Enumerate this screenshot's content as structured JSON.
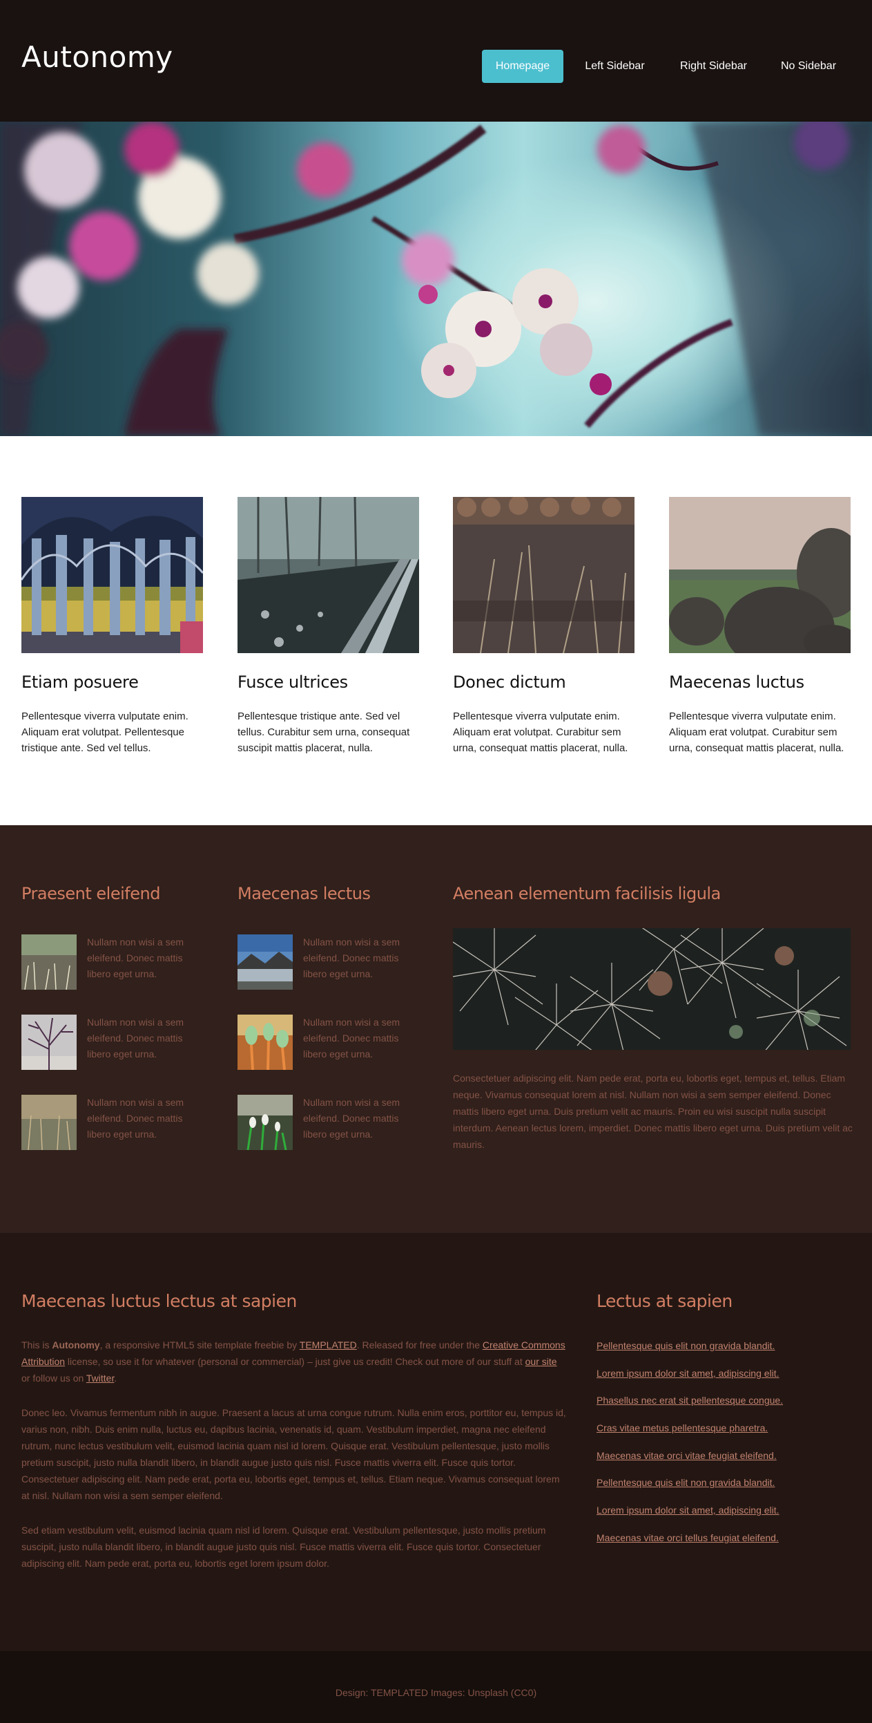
{
  "header": {
    "logo": "Autonomy",
    "nav": [
      "Homepage",
      "Left Sidebar",
      "Right Sidebar",
      "No Sidebar"
    ],
    "active_nav": "Homepage",
    "accent_color": "#4cbfcf"
  },
  "features": [
    {
      "title": "Etiam posuere",
      "text": "Pellentesque viverra vulputate enim. Aliquam erat volutpat. Pellentesque tristique ante. Sed vel tellus."
    },
    {
      "title": "Fusce ultrices",
      "text": "Pellentesque tristique ante. Sed vel tellus. Curabitur sem urna, consequat suscipit mattis placerat, nulla."
    },
    {
      "title": "Donec dictum",
      "text": "Pellentesque viverra vulputate enim. Aliquam erat volutpat. Curabitur sem urna, consequat mattis placerat, nulla."
    },
    {
      "title": "Maecenas luctus",
      "text": "Pellentesque viverra vulputate enim. Aliquam erat volutpat. Curabitur sem urna, consequat mattis placerat, nulla."
    }
  ],
  "mid": {
    "col1": {
      "title": "Praesent eleifend",
      "items": [
        "Nullam non wisi a sem eleifend. Donec mattis libero eget urna.",
        "Nullam non wisi a sem eleifend. Donec mattis libero eget urna.",
        "Nullam non wisi a sem eleifend. Donec mattis libero eget urna."
      ]
    },
    "col2": {
      "title": "Maecenas lectus",
      "items": [
        "Nullam non wisi a sem eleifend. Donec mattis libero eget urna.",
        "Nullam non wisi a sem eleifend. Donec mattis libero eget urna.",
        "Nullam non wisi a sem eleifend. Donec mattis libero eget urna."
      ]
    },
    "col3": {
      "title": "Aenean elementum facilisis ligula",
      "text": "Consectetuer adipiscing elit. Nam pede erat, porta eu, lobortis eget, tempus et, tellus. Etiam neque. Vivamus consequat lorem at nisl. Nullam non wisi a sem semper eleifend. Donec mattis libero eget urna. Duis pretium velit ac mauris. Proin eu wisi suscipit nulla suscipit interdum. Aenean lectus lorem, imperdiet. Donec mattis libero eget urna. Duis pretium velit ac mauris."
    }
  },
  "lower": {
    "left_title": "Maecenas luctus lectus at sapien",
    "intro": {
      "p1": "This is ",
      "brand": "Autonomy",
      "p2": ", a responsive HTML5 site template freebie by ",
      "link1": "TEMPLATED",
      "p3": ". Released for free under the ",
      "link2": "Creative Commons Attribution",
      "p4": " license, so use it for whatever (personal or commercial) – just give us credit! Check out more of our stuff at ",
      "link3": "our site",
      "p5": " or follow us on ",
      "link4": "Twitter",
      "p6": "."
    },
    "para2": "Donec leo. Vivamus fermentum nibh in augue. Praesent a lacus at urna congue rutrum. Nulla enim eros, porttitor eu, tempus id, varius non, nibh. Duis enim nulla, luctus eu, dapibus lacinia, venenatis id, quam. Vestibulum imperdiet, magna nec eleifend rutrum, nunc lectus vestibulum velit, euismod lacinia quam nisl id lorem. Quisque erat. Vestibulum pellentesque, justo mollis pretium suscipit, justo nulla blandit libero, in blandit augue justo quis nisl. Fusce mattis viverra elit. Fusce quis tortor. Consectetuer adipiscing elit. Nam pede erat, porta eu, lobortis eget, tempus et, tellus. Etiam neque. Vivamus consequat lorem at nisl. Nullam non wisi a sem semper eleifend.",
    "para3": "Sed etiam vestibulum velit, euismod lacinia quam nisl id lorem. Quisque erat. Vestibulum pellentesque, justo mollis pretium suscipit, justo nulla blandit libero, in blandit augue justo quis nisl. Fusce mattis viverra elit. Fusce quis tortor. Consectetuer adipiscing elit. Nam pede erat, porta eu, lobortis eget lorem ipsum dolor.",
    "right_title": "Lectus at sapien",
    "links": [
      "Pellentesque quis elit non gravida blandit.",
      "Lorem ipsum dolor sit amet, adipiscing elit.",
      "Phasellus nec erat sit pellentesque congue.",
      "Cras vitae metus pellentesque pharetra.",
      "Maecenas vitae orci vitae feugiat eleifend.",
      "Pellentesque quis elit non gravida blandit.",
      "Lorem ipsum dolor sit amet, adipiscing elit.",
      "Maecenas vitae orci tellus feugiat eleifend."
    ]
  },
  "footer": {
    "text": "Design: TEMPLATED Images: Unsplash (CC0)"
  }
}
